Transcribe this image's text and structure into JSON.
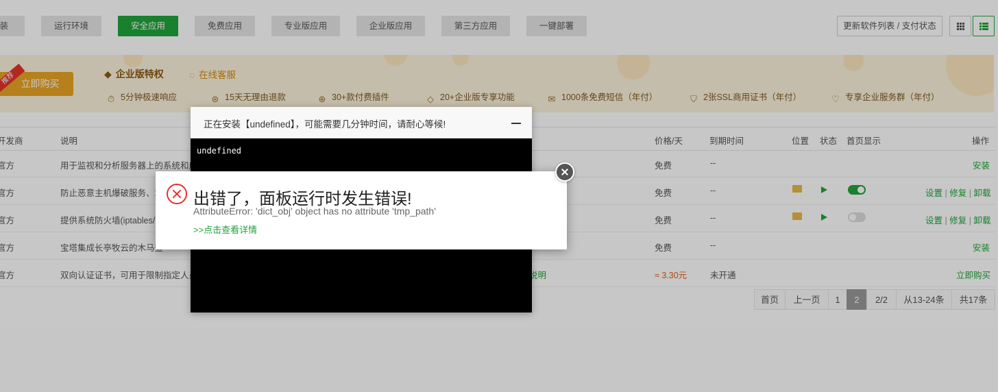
{
  "categories": {
    "install": "安装",
    "runtime": "运行环境",
    "security": "安全应用",
    "free": "免费应用",
    "pro": "专业版应用",
    "enterprise": "企业版应用",
    "thirdparty": "第三方应用",
    "deploy": "一键部署"
  },
  "toolbar": {
    "update_label": "更新软件列表 / 支付状态"
  },
  "banner": {
    "ribbon": "推荐",
    "buy_label": "立即购买",
    "title": "企业版特权",
    "online": "在线客服",
    "perks": [
      "5分钟极速响应",
      "15天无理由退款",
      "30+款付费插件",
      "20+企业版专享功能",
      "1000条免费短信（年付）",
      "2张SSL商用证书（年付）",
      "专享企业服务群（年付）"
    ]
  },
  "table": {
    "headers": {
      "developer": "开发商",
      "desc": "说明",
      "price": "价格/天",
      "expire": "到期时间",
      "location": "位置",
      "status": "状态",
      "home": "首页显示",
      "action": "操作"
    },
    "rows": [
      {
        "developer": "官方",
        "desc": "用于监视和分析服务器上的系统和应",
        "price": "免费",
        "expire": "--",
        "action": "安装"
      },
      {
        "developer": "官方",
        "desc": "防止恶意主机爆破服务、站",
        "price": "免费",
        "expire": "--",
        "actions": [
          "设置",
          "修复",
          "卸载"
        ],
        "home_on": true
      },
      {
        "developer": "官方",
        "desc": "提供系统防火墙(iptables/",
        "price": "免费",
        "expire": "--",
        "actions": [
          "设置",
          "修复",
          "卸载"
        ],
        "home_on": false
      },
      {
        "developer": "官方",
        "desc": "宝塔集成长亭牧云的木马查",
        "price": "免费",
        "expire": "--",
        "action": "安装"
      },
      {
        "developer": "官方",
        "desc": "双向认证证书，可用于限制指定人员",
        "extra": "说明",
        "price": "≈ 3.30元",
        "expire": "未开通",
        "action": "立即购买"
      }
    ],
    "separator": "|"
  },
  "pagination": {
    "first": "首页",
    "prev": "上一页",
    "p1": "1",
    "p2": "2",
    "pages": "2/2",
    "range": "从13-24条",
    "total": "共17条"
  },
  "install_dialog": {
    "title": "正在安装【undefined】，可能需要几分钟时间，请耐心等候!",
    "console": "undefined"
  },
  "error_dialog": {
    "title": "出错了，面板运行时发生错误!",
    "message": "AttributeError: 'dict_obj' object has no attribute 'tmp_path'",
    "link": ">>点击查看详情"
  },
  "colors": {
    "accent": "#20a53a",
    "error": "#e5322d",
    "banner_bg": "#fdf2dc",
    "buy": "#e9a425"
  }
}
